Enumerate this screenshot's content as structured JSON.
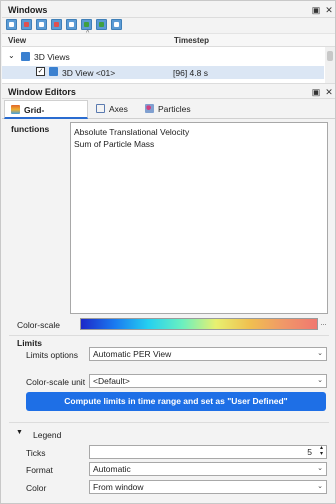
{
  "windows_panel": {
    "title": "Windows",
    "columns": {
      "view": "View",
      "timestep": "Timestep"
    },
    "tree": [
      {
        "label": "3D Views",
        "timestep": ""
      },
      {
        "label": "3D View <01>",
        "timestep": "[96] 4.8 s"
      }
    ]
  },
  "editors_panel": {
    "title": "Window Editors",
    "tabs": [
      {
        "label": "Grid-functions",
        "icon": "grid-functions-icon",
        "color": "#e0642a"
      },
      {
        "label": "Axes",
        "icon": "axes-icon",
        "color": "#5a7ab0"
      },
      {
        "label": "Particles",
        "icon": "particles-icon",
        "color": "#d04080"
      }
    ],
    "grid_functions": [
      "Absolute Translational Velocity",
      "Sum of Particle Mass"
    ],
    "color_scale_label": "Color-scale",
    "color_scale_button": "...",
    "limits": {
      "title": "Limits",
      "options_label": "Limits options",
      "options_value": "Automatic PER View",
      "unit_label": "Color-scale unit",
      "unit_value": "<Default>",
      "compute_button": "Compute limits in time range and set as \"User Defined\""
    },
    "legend": {
      "title": "Legend",
      "ticks_label": "Ticks",
      "ticks_value": "5",
      "format_label": "Format",
      "format_value": "Automatic",
      "color_label": "Color",
      "color_value": "From window"
    }
  },
  "accent_color": "#1e6fe6"
}
